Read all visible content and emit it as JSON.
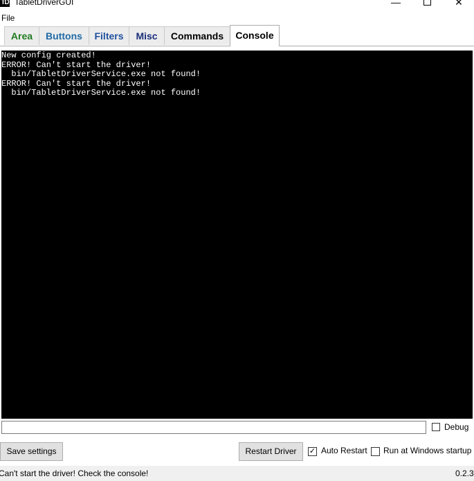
{
  "window": {
    "icon_text": "TD",
    "title": "TabletDriverGUI",
    "minimize_glyph": "—",
    "close_glyph": "✕"
  },
  "menu": {
    "file": "File"
  },
  "tabs": [
    {
      "label": "Area",
      "color": "#1f7a1f"
    },
    {
      "label": "Buttons",
      "color": "#1f6aa7"
    },
    {
      "label": "Filters",
      "color": "#1f4f9e"
    },
    {
      "label": "Misc",
      "color": "#1a2f7a"
    },
    {
      "label": "Commands",
      "color": "#000000"
    },
    {
      "label": "Console",
      "color": "#000000",
      "active": true
    }
  ],
  "console": {
    "background": "#000000",
    "text_color": "#ffffff",
    "text": "New config created!\nERROR! Can't start the driver!\n  bin/TabletDriverService.exe not found!\nERROR! Can't start the driver!\n  bin/TabletDriverService.exe not found!"
  },
  "command_input": {
    "value": ""
  },
  "debug": {
    "label": "Debug",
    "checked": false
  },
  "buttons": {
    "save_settings": "Save settings",
    "restart_driver": "Restart Driver"
  },
  "auto_restart": {
    "label": "Auto Restart",
    "checked": true,
    "check_glyph": "✓"
  },
  "run_at_startup": {
    "label": "Run at Windows startup",
    "checked": false
  },
  "status": {
    "message": "Can't start the driver! Check the console!",
    "version": "0.2.3"
  }
}
